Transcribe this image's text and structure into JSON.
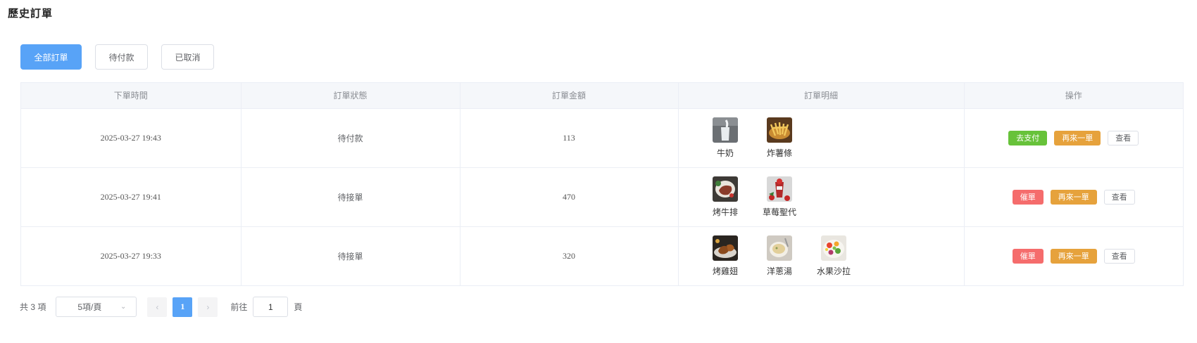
{
  "page": {
    "title": "歷史訂單"
  },
  "filters": [
    {
      "label": "全部訂單",
      "active": true
    },
    {
      "label": "待付款",
      "active": false
    },
    {
      "label": "已取消",
      "active": false
    }
  ],
  "table": {
    "headers": [
      "下單時間",
      "訂單狀態",
      "訂單金額",
      "訂單明細",
      "操作"
    ],
    "rows": [
      {
        "time": "2025-03-27 19:43",
        "status": "待付款",
        "amount": "113",
        "items": [
          {
            "name": "牛奶",
            "icon": "milk-image"
          },
          {
            "name": "炸薯條",
            "icon": "fries-image"
          }
        ],
        "actions": [
          {
            "label": "去支付",
            "kind": "pay"
          },
          {
            "label": "再來一單",
            "kind": "again"
          },
          {
            "label": "查看",
            "kind": "view"
          }
        ]
      },
      {
        "time": "2025-03-27 19:41",
        "status": "待接單",
        "amount": "470",
        "items": [
          {
            "name": "烤牛排",
            "icon": "steak-image"
          },
          {
            "name": "草莓聖代",
            "icon": "sundae-image"
          }
        ],
        "actions": [
          {
            "label": "催單",
            "kind": "urge"
          },
          {
            "label": "再來一單",
            "kind": "again"
          },
          {
            "label": "查看",
            "kind": "view"
          }
        ]
      },
      {
        "time": "2025-03-27 19:33",
        "status": "待接單",
        "amount": "320",
        "items": [
          {
            "name": "烤雞翅",
            "icon": "chicken-wings-image"
          },
          {
            "name": "洋蔥湯",
            "icon": "onion-soup-image"
          },
          {
            "name": "水果沙拉",
            "icon": "fruit-salad-image"
          }
        ],
        "actions": [
          {
            "label": "催單",
            "kind": "urge"
          },
          {
            "label": "再來一單",
            "kind": "again"
          },
          {
            "label": "查看",
            "kind": "view"
          }
        ]
      }
    ]
  },
  "pagination": {
    "total": "共 3 項",
    "page_size": "5項/頁",
    "prev_icon": "‹",
    "next_icon": "›",
    "current_page": "1",
    "goto_label": "前往",
    "goto_value": "1",
    "goto_suffix": "頁"
  },
  "colors": {
    "primary": "#58a3f7",
    "pay": "#67c23a",
    "again": "#e6a23c",
    "urge": "#f56c6c"
  }
}
